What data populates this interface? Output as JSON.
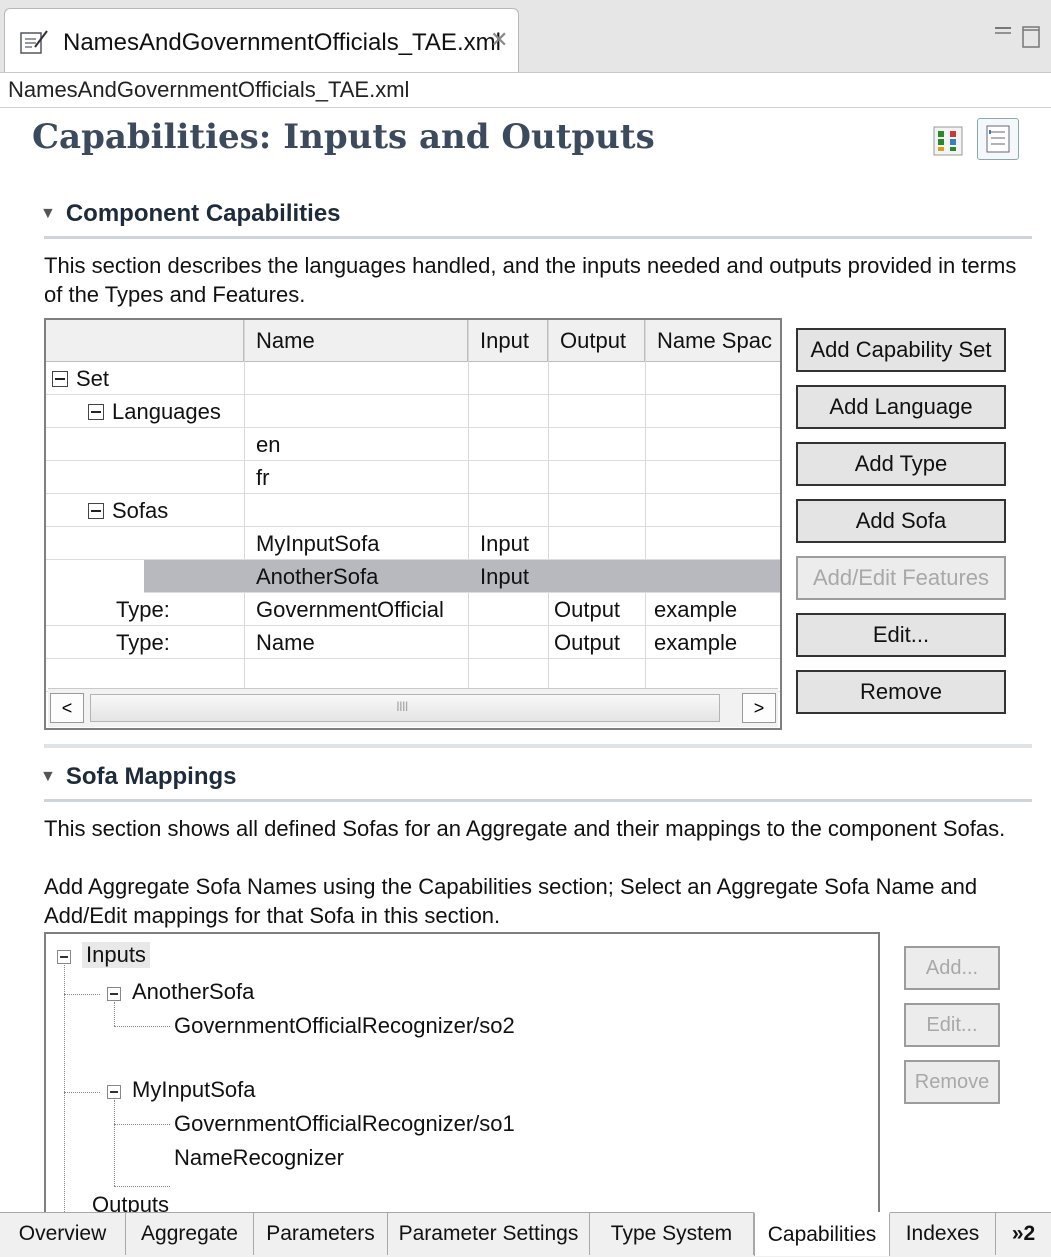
{
  "editor_tab": {
    "title": "NamesAndGovernmentOfficials_TAE.xml",
    "close_glyph": "✕"
  },
  "file_path": "NamesAndGovernmentOfficials_TAE.xml",
  "page_title": "Capabilities: Inputs and Outputs",
  "component_capabilities": {
    "header": "Component Capabilities",
    "description": "This section describes the languages handled, and the inputs needed and outputs provided in terms of the Types and Features.",
    "columns": [
      "",
      "Name",
      "Input",
      "Output",
      "Name Spac"
    ],
    "rows": [
      {
        "tree": "Set",
        "name": "",
        "input": "",
        "output": "",
        "ns": ""
      },
      {
        "tree": "Languages",
        "name": "",
        "input": "",
        "output": "",
        "ns": ""
      },
      {
        "tree": "",
        "name": "en",
        "input": "",
        "output": "",
        "ns": ""
      },
      {
        "tree": "",
        "name": "fr",
        "input": "",
        "output": "",
        "ns": ""
      },
      {
        "tree": "Sofas",
        "name": "",
        "input": "",
        "output": "",
        "ns": ""
      },
      {
        "tree": "",
        "name": "MyInputSofa",
        "input": "Input",
        "output": "",
        "ns": ""
      },
      {
        "tree": "",
        "name": "AnotherSofa",
        "input": "Input",
        "output": "",
        "ns": ""
      },
      {
        "tree": "Type:",
        "name": "GovernmentOfficial",
        "input": "",
        "output": "Output",
        "ns": "example"
      },
      {
        "tree": "Type:",
        "name": "Name",
        "input": "",
        "output": "Output",
        "ns": "example"
      }
    ],
    "selected_row": "AnotherSofa",
    "buttons": {
      "add_capability_set": "Add Capability Set",
      "add_language": "Add Language",
      "add_type": "Add Type",
      "add_sofa": "Add Sofa",
      "add_edit_features": "Add/Edit Features",
      "edit": "Edit...",
      "remove": "Remove"
    },
    "scroll": {
      "left": "<",
      "right": ">",
      "grip": "IIII"
    }
  },
  "sofa_mappings": {
    "header": "Sofa Mappings",
    "description_1": "This section shows all defined Sofas for an Aggregate and their mappings to the component Sofas.",
    "description_2": "Add Aggregate Sofa Names using the Capabilities section; Select an Aggregate Sofa Name and Add/Edit mappings for that Sofa in this section.",
    "tree": {
      "inputs": "Inputs",
      "another_sofa": "AnotherSofa",
      "another_sofa_map": "GovernmentOfficialRecognizer/so2",
      "my_input_sofa": "MyInputSofa",
      "my_input_sofa_map_1": "GovernmentOfficialRecognizer/so1",
      "my_input_sofa_map_2": "NameRecognizer",
      "outputs": "Outputs"
    },
    "buttons": {
      "add": "Add...",
      "edit": "Edit...",
      "remove": "Remove"
    }
  },
  "page_tabs": [
    "Overview",
    "Aggregate",
    "Parameters",
    "Parameter Settings",
    "Type System",
    "Capabilities",
    "Indexes"
  ],
  "active_tab": "Capabilities",
  "more_tabs": "»2"
}
